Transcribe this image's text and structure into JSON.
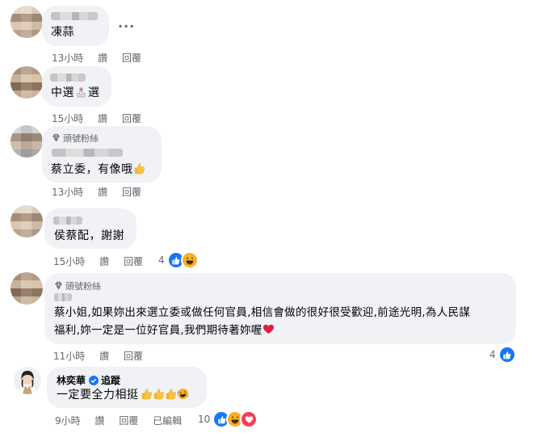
{
  "comments": [
    {
      "text": "凍蒜",
      "time": "13小時",
      "like": "讚",
      "reply": "回覆",
      "more": "···"
    },
    {
      "text": "中選",
      "text_after": "選",
      "time": "15小時",
      "like": "讚",
      "reply": "回覆"
    },
    {
      "badge": "頭號粉絲",
      "text": "蔡立委，有像哦",
      "time": "13小時",
      "like": "讚",
      "reply": "回覆"
    },
    {
      "text": "侯蔡配，謝謝",
      "time": "15小時",
      "like": "讚",
      "reply": "回覆",
      "reaction_count": "4"
    },
    {
      "badge": "頭號粉絲",
      "line1": "蔡小姐,如果妳出來選立委或做任何官員,相信會做的很好很受歡迎,前途光明,為人民謀",
      "line2": "福利,妳一定是一位好官員,我們期待著妳喔",
      "time": "11小時",
      "like": "讚",
      "reply": "回覆",
      "reaction_count": "4"
    },
    {
      "name": "林奕華",
      "follow": "追蹤",
      "text": "一定要全力相挺",
      "time": "9小時",
      "like": "讚",
      "reply": "回覆",
      "edited": "已編輯",
      "reaction_count": "10"
    }
  ],
  "colors": {
    "like": "#1877f2",
    "haha": "#f7b125",
    "love": "#f33e58",
    "bubble": "#f0f2f5",
    "meta": "#65676b"
  },
  "icons": [
    "thumbs-up-icon",
    "haha-icon",
    "love-icon",
    "diamond-badge-icon",
    "verified-icon",
    "ballot-box-icon",
    "heart-icon",
    "more-options-icon"
  ]
}
